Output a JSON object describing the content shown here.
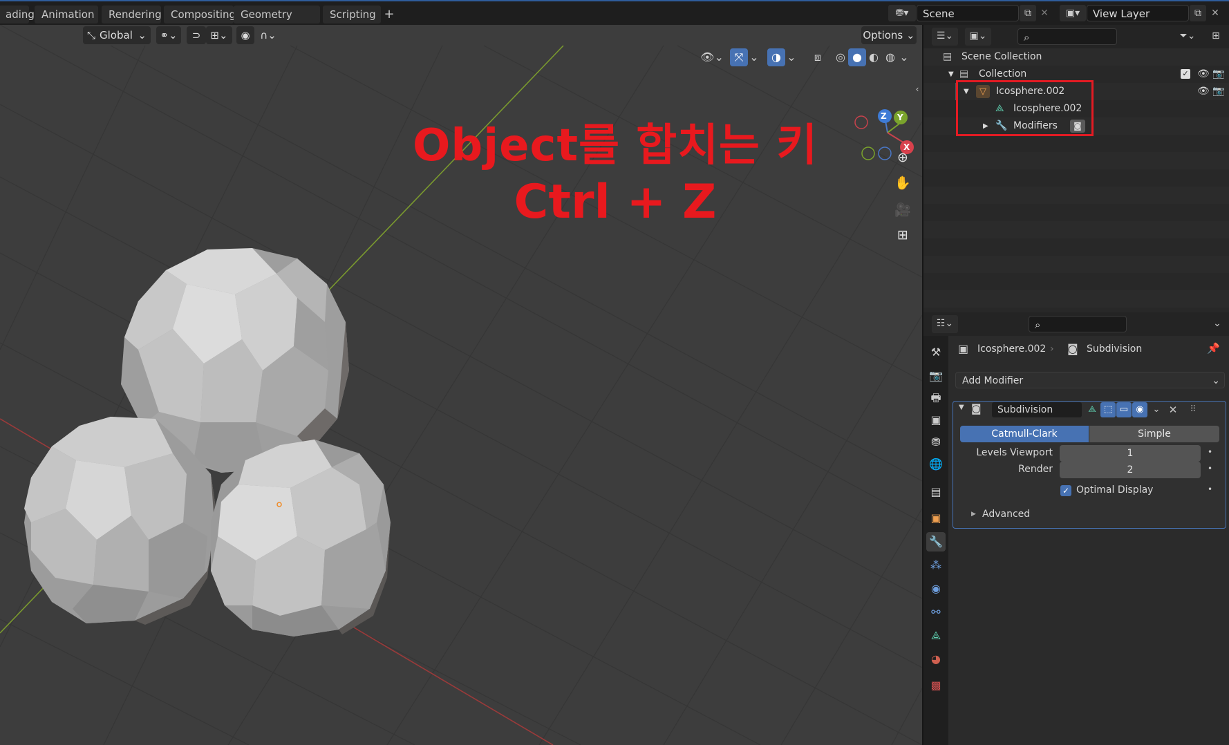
{
  "workspace_tabs": [
    "ading",
    "Animation",
    "Rendering",
    "Compositing",
    "Geometry Nodes",
    "Scripting"
  ],
  "add_workspace_label": "+",
  "scene": {
    "label": "Scene"
  },
  "view_layer": {
    "label": "View Layer"
  },
  "viewport": {
    "transform_orientation": "Global",
    "options_label": "Options",
    "overlay_line1": "Object를 합치는 키",
    "overlay_line2": "Ctrl + Z",
    "gizmo_axes": {
      "z": "Z",
      "y": "Y",
      "x": "X"
    }
  },
  "outliner": {
    "rows": [
      {
        "label": "Scene Collection",
        "icon": "scene-collection-icon"
      },
      {
        "label": "Collection",
        "icon": "collection-icon"
      },
      {
        "label": "Icosphere.002",
        "icon": "object-icon"
      },
      {
        "label": "Icosphere.002",
        "icon": "mesh-data-icon"
      },
      {
        "label": "Modifiers",
        "icon": "wrench-icon"
      }
    ]
  },
  "properties": {
    "breadcrumb_object": "Icosphere.002",
    "breadcrumb_modifier": "Subdivision",
    "add_modifier_label": "Add Modifier",
    "modifier_name": "Subdivision",
    "mode_catmull": "Catmull-Clark",
    "mode_simple": "Simple",
    "levels_viewport_label": "Levels Viewport",
    "levels_viewport_value": "1",
    "render_label": "Render",
    "render_value": "2",
    "optimal_display_label": "Optimal Display",
    "optimal_display_checked": true,
    "advanced_label": "Advanced"
  },
  "colors": {
    "accent_blue": "#4772b3",
    "highlight_red": "#e31b23",
    "viewport_bg": "#3d3d3d"
  }
}
